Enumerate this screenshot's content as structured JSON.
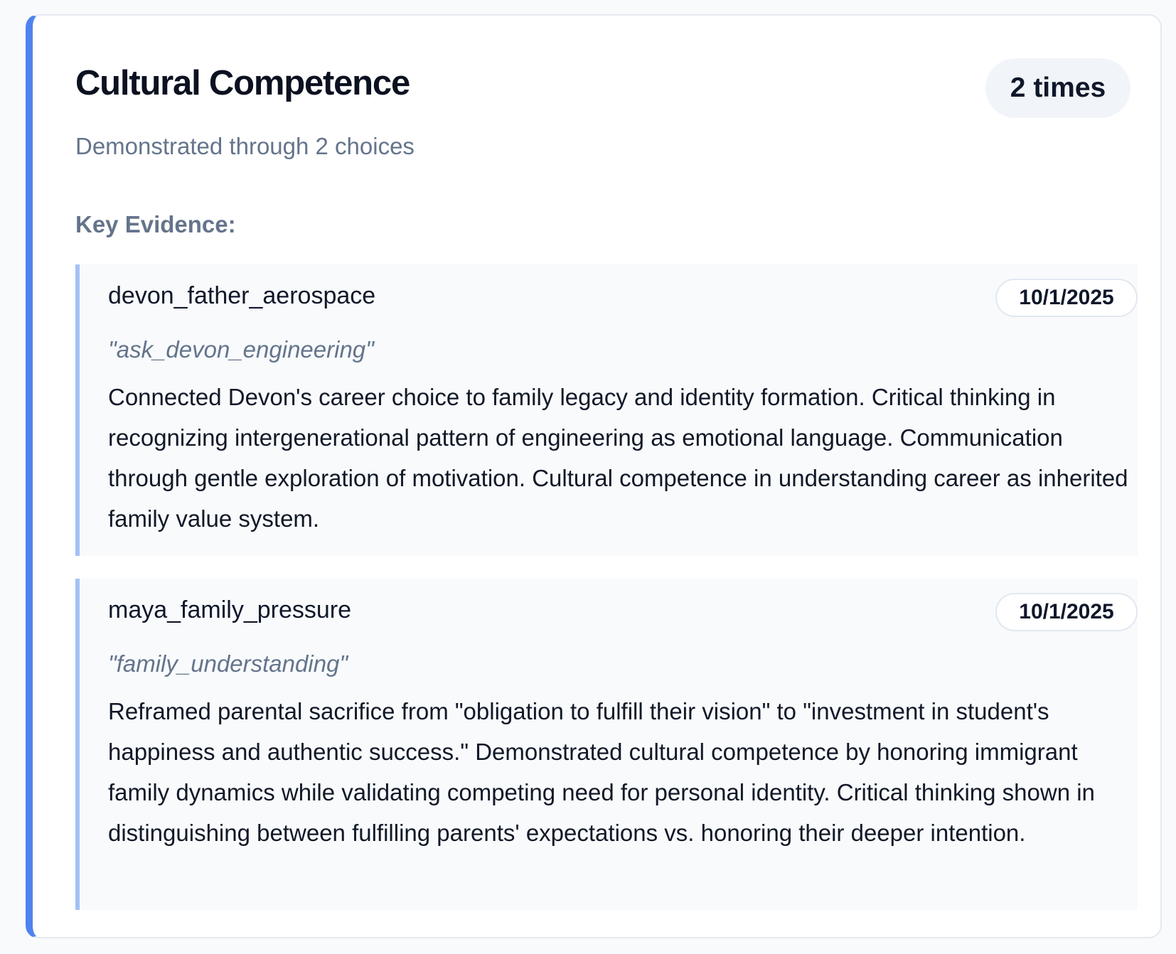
{
  "skill": {
    "title": "Cultural Competence",
    "subtitle": "Demonstrated through 2 choices",
    "count_badge": "2 times",
    "accent_color": "#4f82ee"
  },
  "evidence_section": {
    "label": "Key Evidence:",
    "items": [
      {
        "scene": "devon_father_aerospace",
        "date": "10/1/2025",
        "choice": "\"ask_devon_engineering\"",
        "text": "Connected Devon's career choice to family legacy and identity formation. Critical thinking in recognizing intergenerational pattern of engineering as emotional language. Communication through gentle exploration of motivation. Cultural competence in understanding career as inherited family value system."
      },
      {
        "scene": "maya_family_pressure",
        "date": "10/1/2025",
        "choice": "\"family_understanding\"",
        "text": "Reframed parental sacrifice from \"obligation to fulfill their vision\" to \"investment in student's happiness and authentic success.\" Demonstrated cultural competence by honoring immigrant family dynamics while validating competing need for personal identity. Critical thinking shown in distinguishing between fulfilling parents' expectations vs. honoring their deeper intention."
      }
    ]
  }
}
